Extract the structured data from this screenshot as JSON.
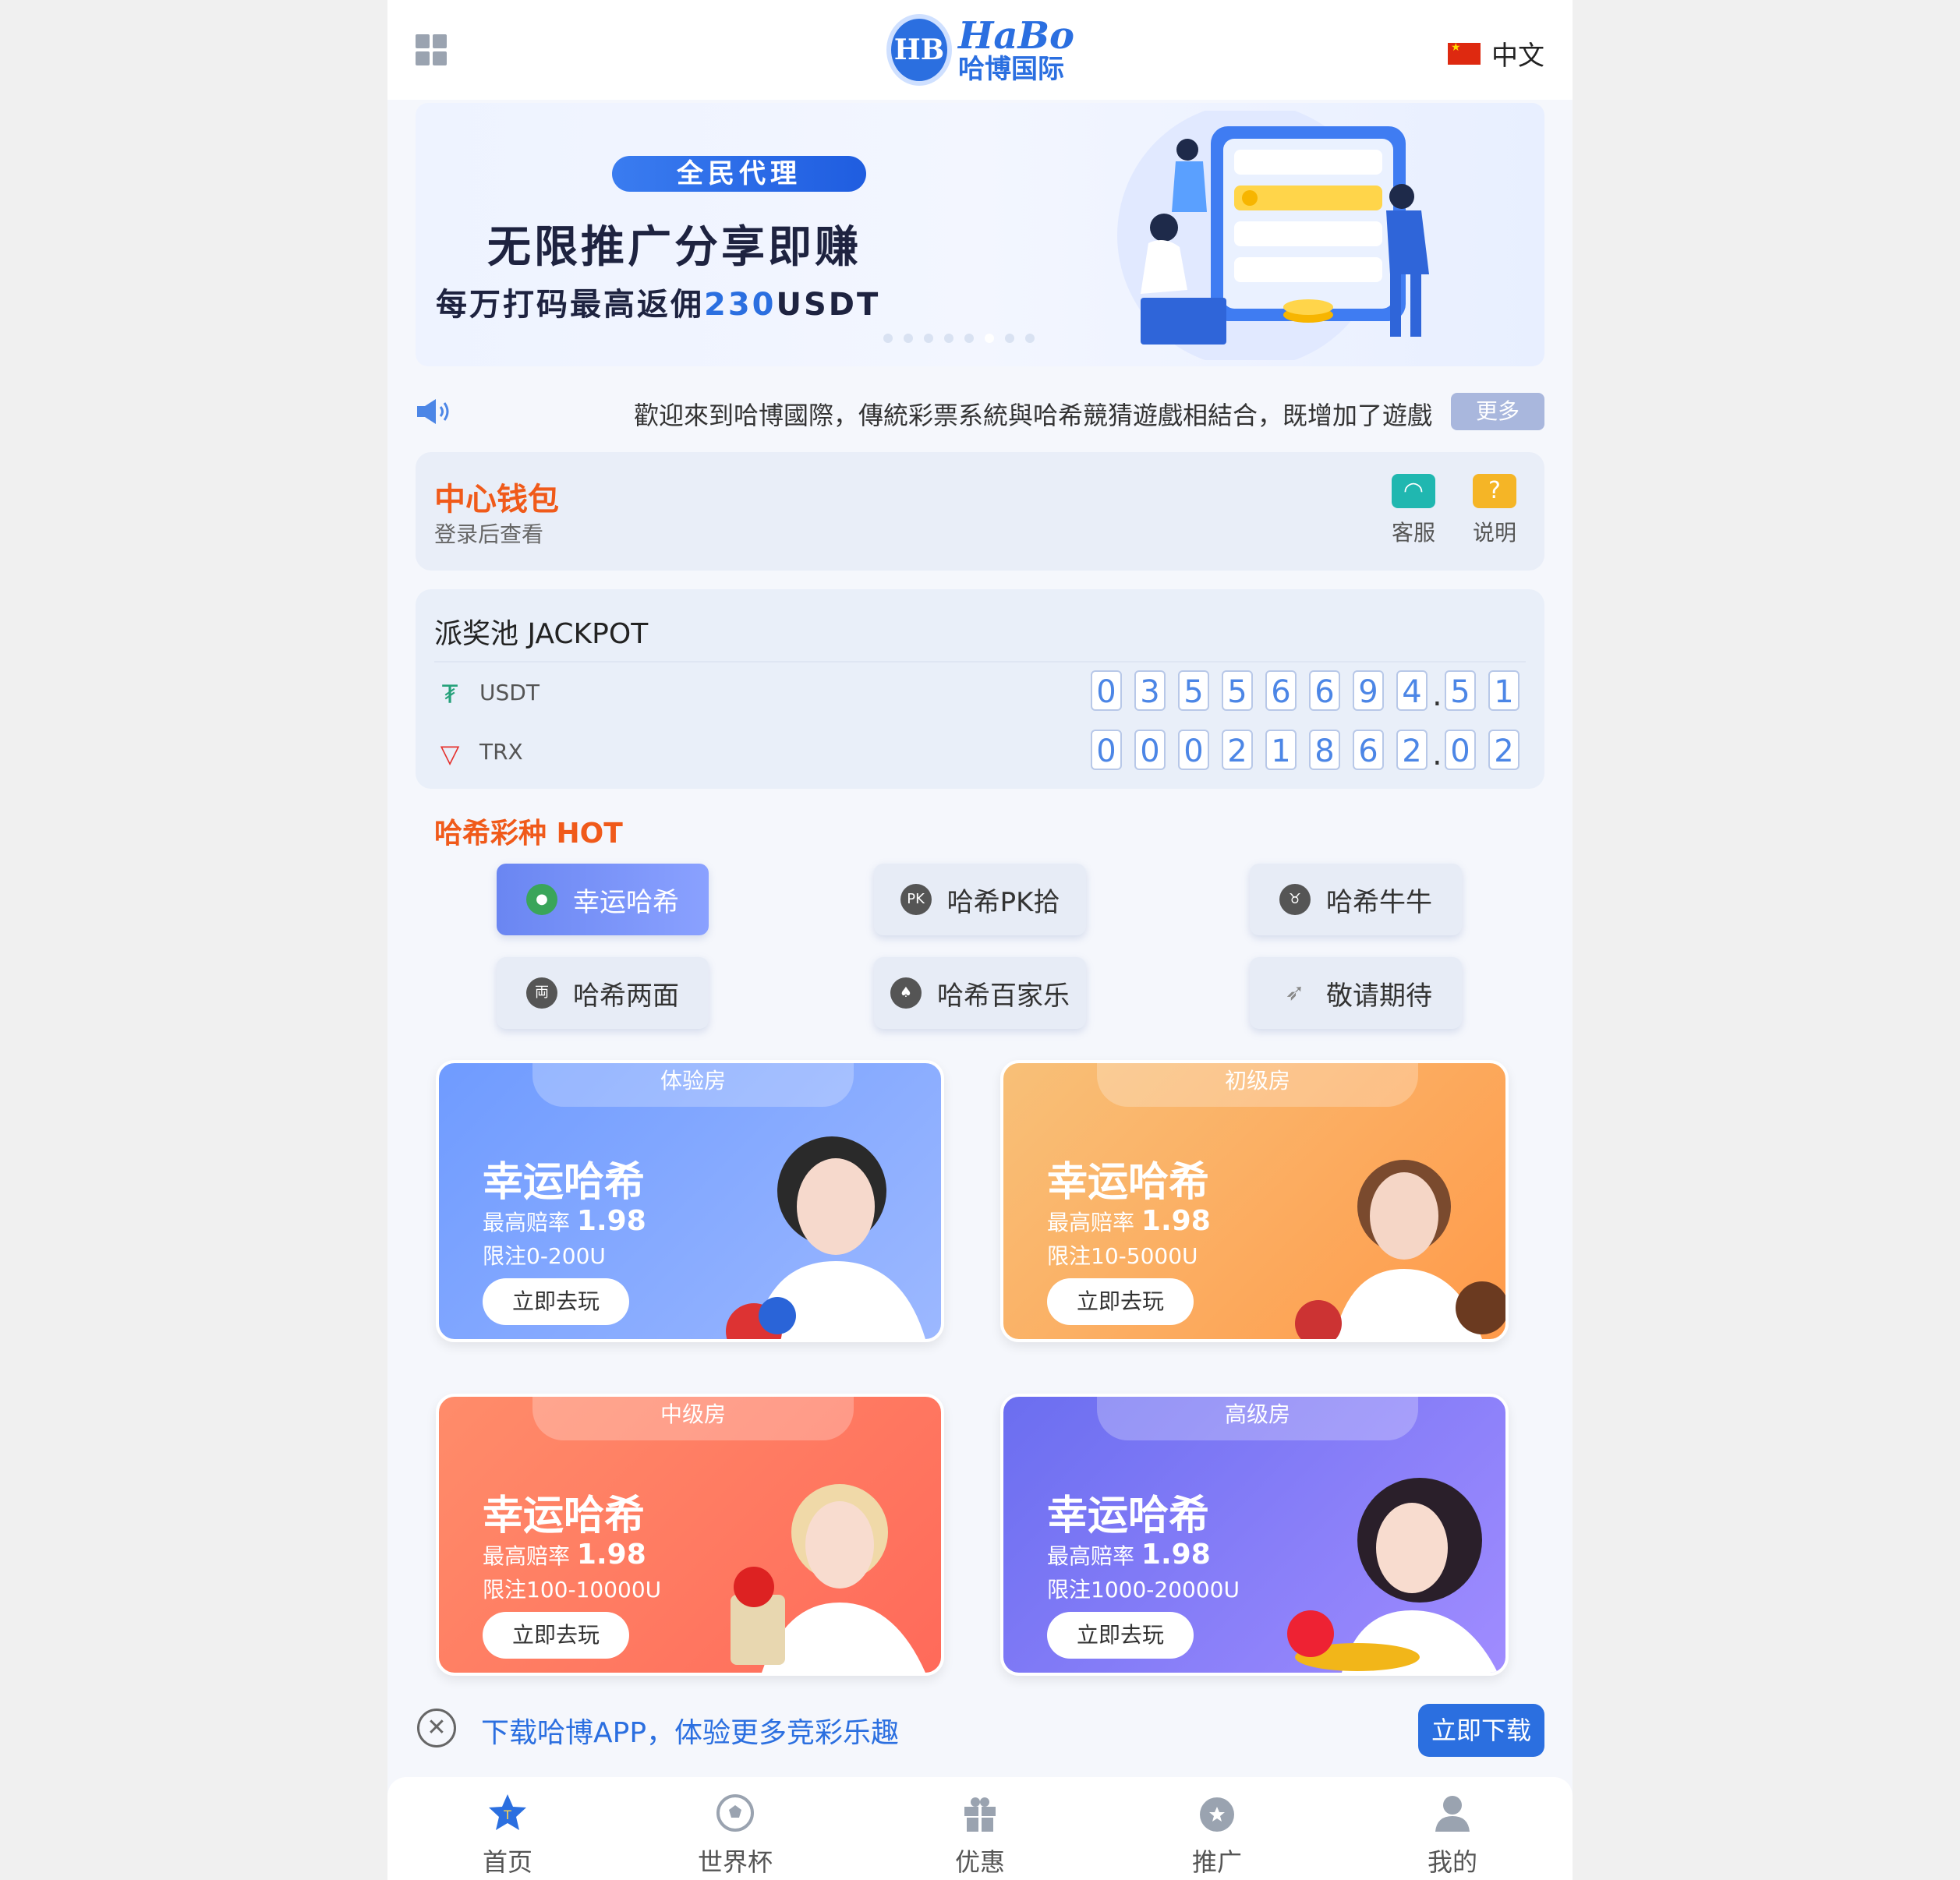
{
  "header": {
    "logo_badge": "HB",
    "logo_en": "HaBo",
    "logo_cn": "哈博国际",
    "lang": "中文"
  },
  "banner": {
    "pill": "全民代理",
    "headline": "无限推广分享即赚",
    "subline_prefix": "每万打码最高返佣",
    "subline_highlight": "230",
    "subline_suffix": "USDT"
  },
  "notice": {
    "text": "歡迎來到哈博國際，傳統彩票系統與哈希競猜遊戲相結合，既增加了遊戲",
    "more": "更多"
  },
  "wallet": {
    "title": "中心钱包",
    "subtitle": "登录后查看",
    "service": "客服",
    "help": "说明"
  },
  "jackpot": {
    "title": "派奖池 JACKPOT",
    "rows": [
      {
        "name": "USDT",
        "digits": [
          "0",
          "3",
          "5",
          "5",
          "6",
          "6",
          "9",
          "4",
          ".",
          "5",
          "1"
        ]
      },
      {
        "name": "TRX",
        "digits": [
          "0",
          "0",
          "0",
          "2",
          "1",
          "8",
          "6",
          "2",
          ".",
          "0",
          "2"
        ]
      }
    ]
  },
  "hot": {
    "title": "哈希彩种 HOT",
    "games": [
      "幸运哈希",
      "哈希PK拾",
      "哈希牛牛",
      "哈希两面",
      "哈希百家乐",
      "敬请期待"
    ]
  },
  "rooms": [
    {
      "tab": "体验房",
      "title": "幸运哈希",
      "odds_label": "最高赔率",
      "odds": "1.98",
      "limit_label": "限注",
      "limit": "0-200U",
      "play": "立即去玩"
    },
    {
      "tab": "初级房",
      "title": "幸运哈希",
      "odds_label": "最高赔率",
      "odds": "1.98",
      "limit_label": "限注",
      "limit": "10-5000U",
      "play": "立即去玩"
    },
    {
      "tab": "中级房",
      "title": "幸运哈希",
      "odds_label": "最高赔率",
      "odds": "1.98",
      "limit_label": "限注",
      "limit": "100-10000U",
      "play": "立即去玩"
    },
    {
      "tab": "高级房",
      "title": "幸运哈希",
      "odds_label": "最高赔率",
      "odds": "1.98",
      "limit_label": "限注",
      "limit": "1000-20000U",
      "play": "立即去玩"
    }
  ],
  "download": {
    "text": "下载哈博APP，体验更多竞彩乐趣",
    "button": "立即下载"
  },
  "tabbar": [
    "首页",
    "世界杯",
    "优惠",
    "推广",
    "我的"
  ],
  "colors": {
    "brand": "#2b6fe0",
    "accent_orange": "#f05a1a"
  }
}
